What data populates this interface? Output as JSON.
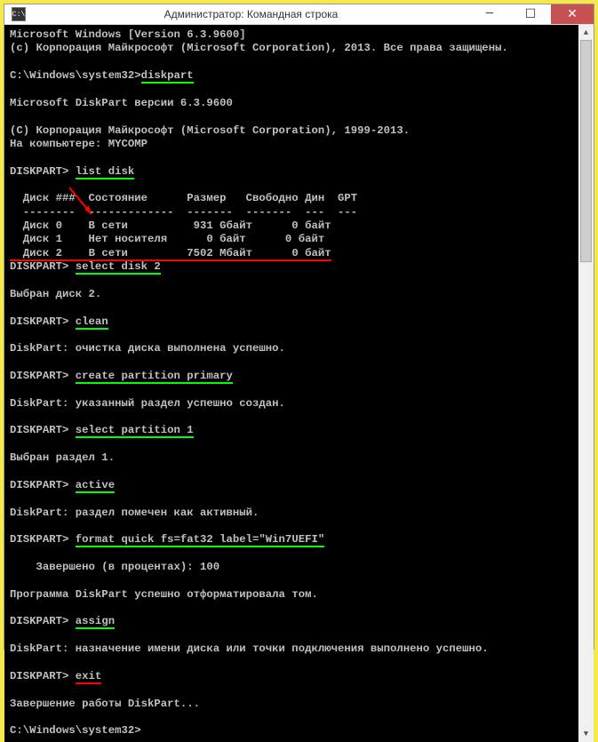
{
  "title": "Администратор: Командная строка",
  "icon_label": "C:\\",
  "lines": {
    "l0": "Microsoft Windows [Version 6.3.9600]",
    "l1": "(c) Корпорация Майкрософт (Microsoft Corporation), 2013. Все права защищены.",
    "l2_prompt": "C:\\Windows\\system32>",
    "l2_cmd": "diskpart",
    "l3": "Microsoft DiskPart версии 6.3.9600",
    "l4": "(C) Корпорация Майкрософт (Microsoft Corporation), 1999-2013.",
    "l5": "На компьютере: MYCOMP",
    "l6_prompt": "DISKPART> ",
    "l6_cmd": "list disk",
    "tbl_hdr": "  Диск ###  Состояние      Размер   Свободно Дин  GPT",
    "tbl_sep": "  --------  -------------  -------  -------  ---  ---",
    "tbl_r0": "  Диск 0    В сети          931 Gбайт      0 байт",
    "tbl_r1": "  Диск 1    Нет носителя      0 байт      0 байт",
    "tbl_r2_a": "  Диск 2",
    "tbl_r2_b": "    В сети         7502 Mбайт      0 байт",
    "l7_prompt": "DISKPART> ",
    "l7_cmd": "select disk 2",
    "l8": "Выбран диск 2.",
    "l9_prompt": "DISKPART> ",
    "l9_cmd": "clean",
    "l10": "DiskPart: очистка диска выполнена успешно.",
    "l11_prompt": "DISKPART> ",
    "l11_cmd": "create partition primary",
    "l12": "DiskPart: указанный раздел успешно создан.",
    "l13_prompt": "DISKPART> ",
    "l13_cmd": "select partition 1",
    "l14": "Выбран раздел 1.",
    "l15_prompt": "DISKPART> ",
    "l15_cmd": "active",
    "l16": "DiskPart: раздел помечен как активный.",
    "l17_prompt": "DISKPART> ",
    "l17_cmd": "format quick fs=fat32 label=\"Win7UEFI\"",
    "l18": "    Завершено (в процентах): 100",
    "l19": "Программа DiskPart успешно отформатировала том.",
    "l20_prompt": "DISKPART> ",
    "l20_cmd": "assign",
    "l21": "DiskPart: назначение имени диска или точки подключения выполнено успешно.",
    "l22_prompt": "DISKPART> ",
    "l22_cmd": "exit",
    "l23": "Завершение работы DiskPart...",
    "l24": "C:\\Windows\\system32>"
  }
}
